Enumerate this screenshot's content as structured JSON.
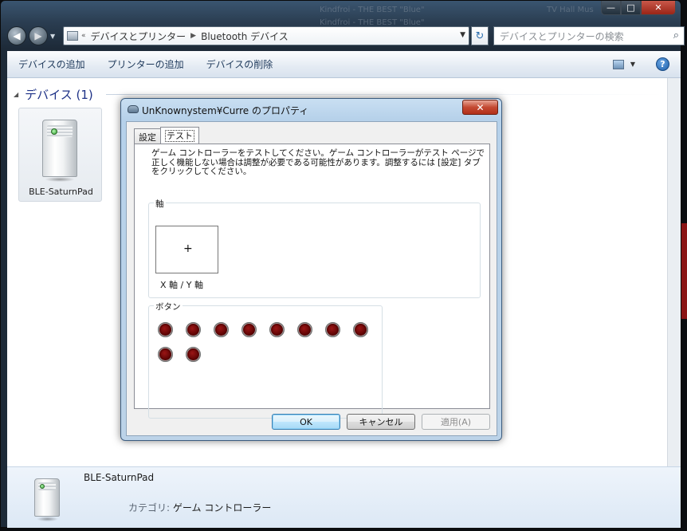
{
  "window": {
    "caption_buttons": {
      "minimize": "—",
      "maximize": "□",
      "close": "✕"
    },
    "background_tabs": [
      "Kindfroi - THE BEST \"Blue\"",
      "TV Hall Mus",
      "Kindfroi - THE BEST \"Blue\""
    ]
  },
  "nav": {
    "back_icon": "arrow-left-icon",
    "forward_icon": "arrow-right-icon",
    "breadcrumb_overflow": "«",
    "breadcrumb": [
      "デバイスとプリンター",
      "Bluetooth デバイス"
    ],
    "search_placeholder": "デバイスとプリンターの検索"
  },
  "toolbar": {
    "items": [
      "デバイスの追加",
      "プリンターの追加",
      "デバイスの削除"
    ],
    "help_label": "?"
  },
  "content": {
    "group_header": "デバイス (1)",
    "devices": [
      {
        "label": "BLE-SaturnPad"
      }
    ]
  },
  "details": {
    "device_name": "BLE-SaturnPad",
    "category_label": "カテゴリ:",
    "category_value": "ゲーム コントローラー"
  },
  "dialog": {
    "title": "UnKnownystem¥Curre のプロパティ",
    "close_label": "✕",
    "tabs": [
      "設定",
      "テスト"
    ],
    "active_tab": "テスト",
    "intro_text": "ゲーム コントローラーをテストしてください。ゲーム コントローラーがテスト ページで正しく機能しない場合は調整が必要である可能性があります。調整するには [設定] タブをクリックしてください。",
    "axes_label": "軸",
    "axis_marker": "+",
    "axis_caption": "X 軸 / Y 軸",
    "buttons_label": "ボタン",
    "button_count": 10,
    "ok_label": "OK",
    "cancel_label": "キャンセル",
    "apply_label": "適用(A)"
  },
  "colors": {
    "button_indicator": "#5b0404",
    "link_text": "#1e3287",
    "toolbar_text": "#1e395b"
  }
}
